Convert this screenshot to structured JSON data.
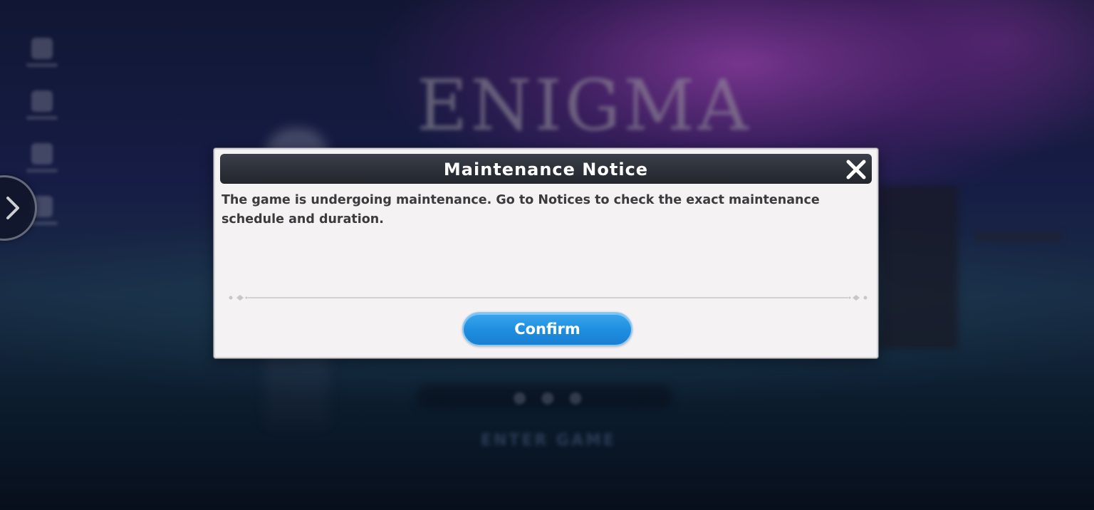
{
  "background": {
    "logo_text": "ENIGMA",
    "enter_label": "ENTER GAME"
  },
  "side_menu": {
    "expand_icon": "chevron-right-icon",
    "item_count_visible": 4
  },
  "dialog": {
    "title": "Maintenance Notice",
    "close_icon": "close-icon",
    "message": "The game is undergoing maintenance. Go to Notices to check the exact maintenance schedule and duration.",
    "confirm_label": "Confirm"
  },
  "colors": {
    "header_bg": "#2c3038",
    "dialog_bg": "#f4f2f3",
    "confirm_bg": "#1f8fe0",
    "message_text": "#3b3b3d"
  }
}
